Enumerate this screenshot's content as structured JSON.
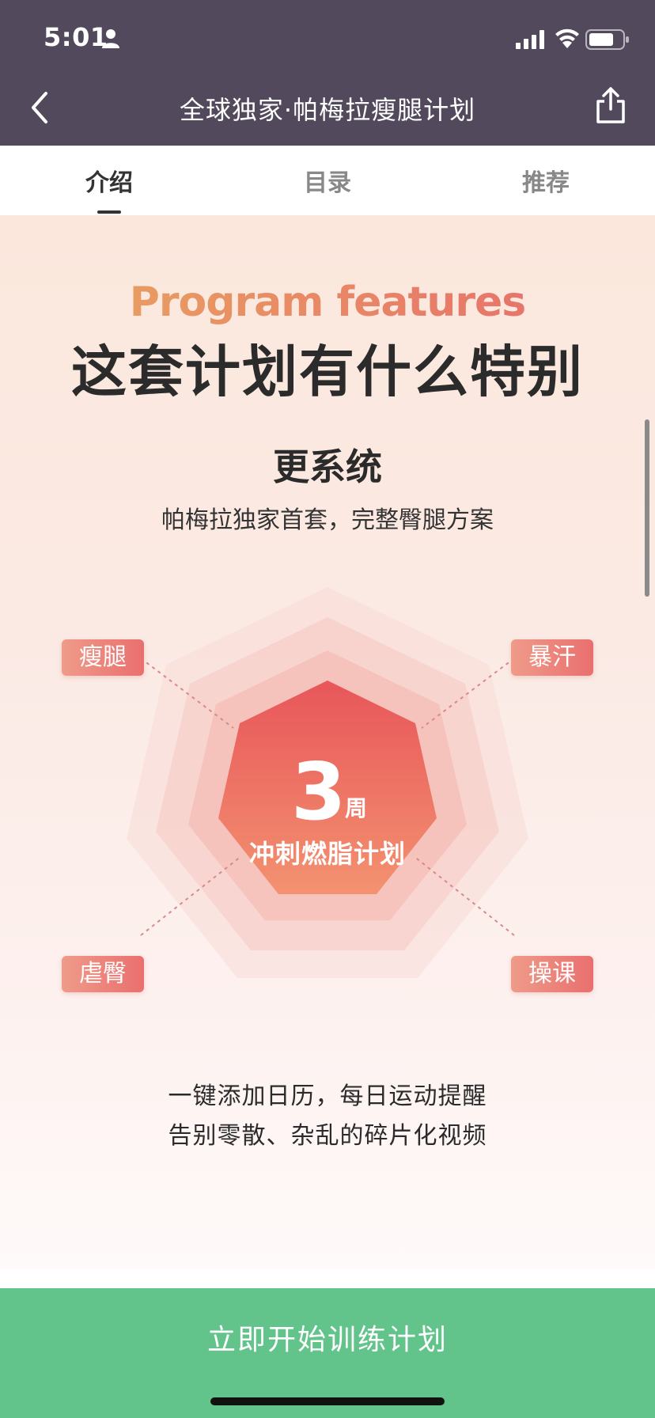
{
  "status_bar": {
    "time": "5:01"
  },
  "nav": {
    "title": "全球独家·帕梅拉瘦腿计划"
  },
  "tabs": [
    {
      "label": "介绍",
      "active": true
    },
    {
      "label": "目录",
      "active": false
    },
    {
      "label": "推荐",
      "active": false
    }
  ],
  "content": {
    "headline_en": "Program features",
    "headline_cn": "这套计划有什么特别",
    "subtitle": "更系统",
    "subtitle_desc": "帕梅拉独家首套，完整臀腿方案",
    "center": {
      "number": "3",
      "unit": "周",
      "label": "冲刺燃脂计划"
    },
    "tags": {
      "top_left": "瘦腿",
      "top_right": "暴汗",
      "bottom_left": "虐臀",
      "bottom_right": "操课"
    },
    "bottom_lines": [
      "一键添加日历，每日运动提醒",
      "告别零散、杂乱的碎片化视频"
    ]
  },
  "cta": {
    "label": "立即开始训练计划"
  },
  "colors": {
    "header_bg": "#524a5c",
    "cta_bg": "#62c48b",
    "accent_red": "#e96f6e",
    "accent_orange": "#e8a85e"
  }
}
